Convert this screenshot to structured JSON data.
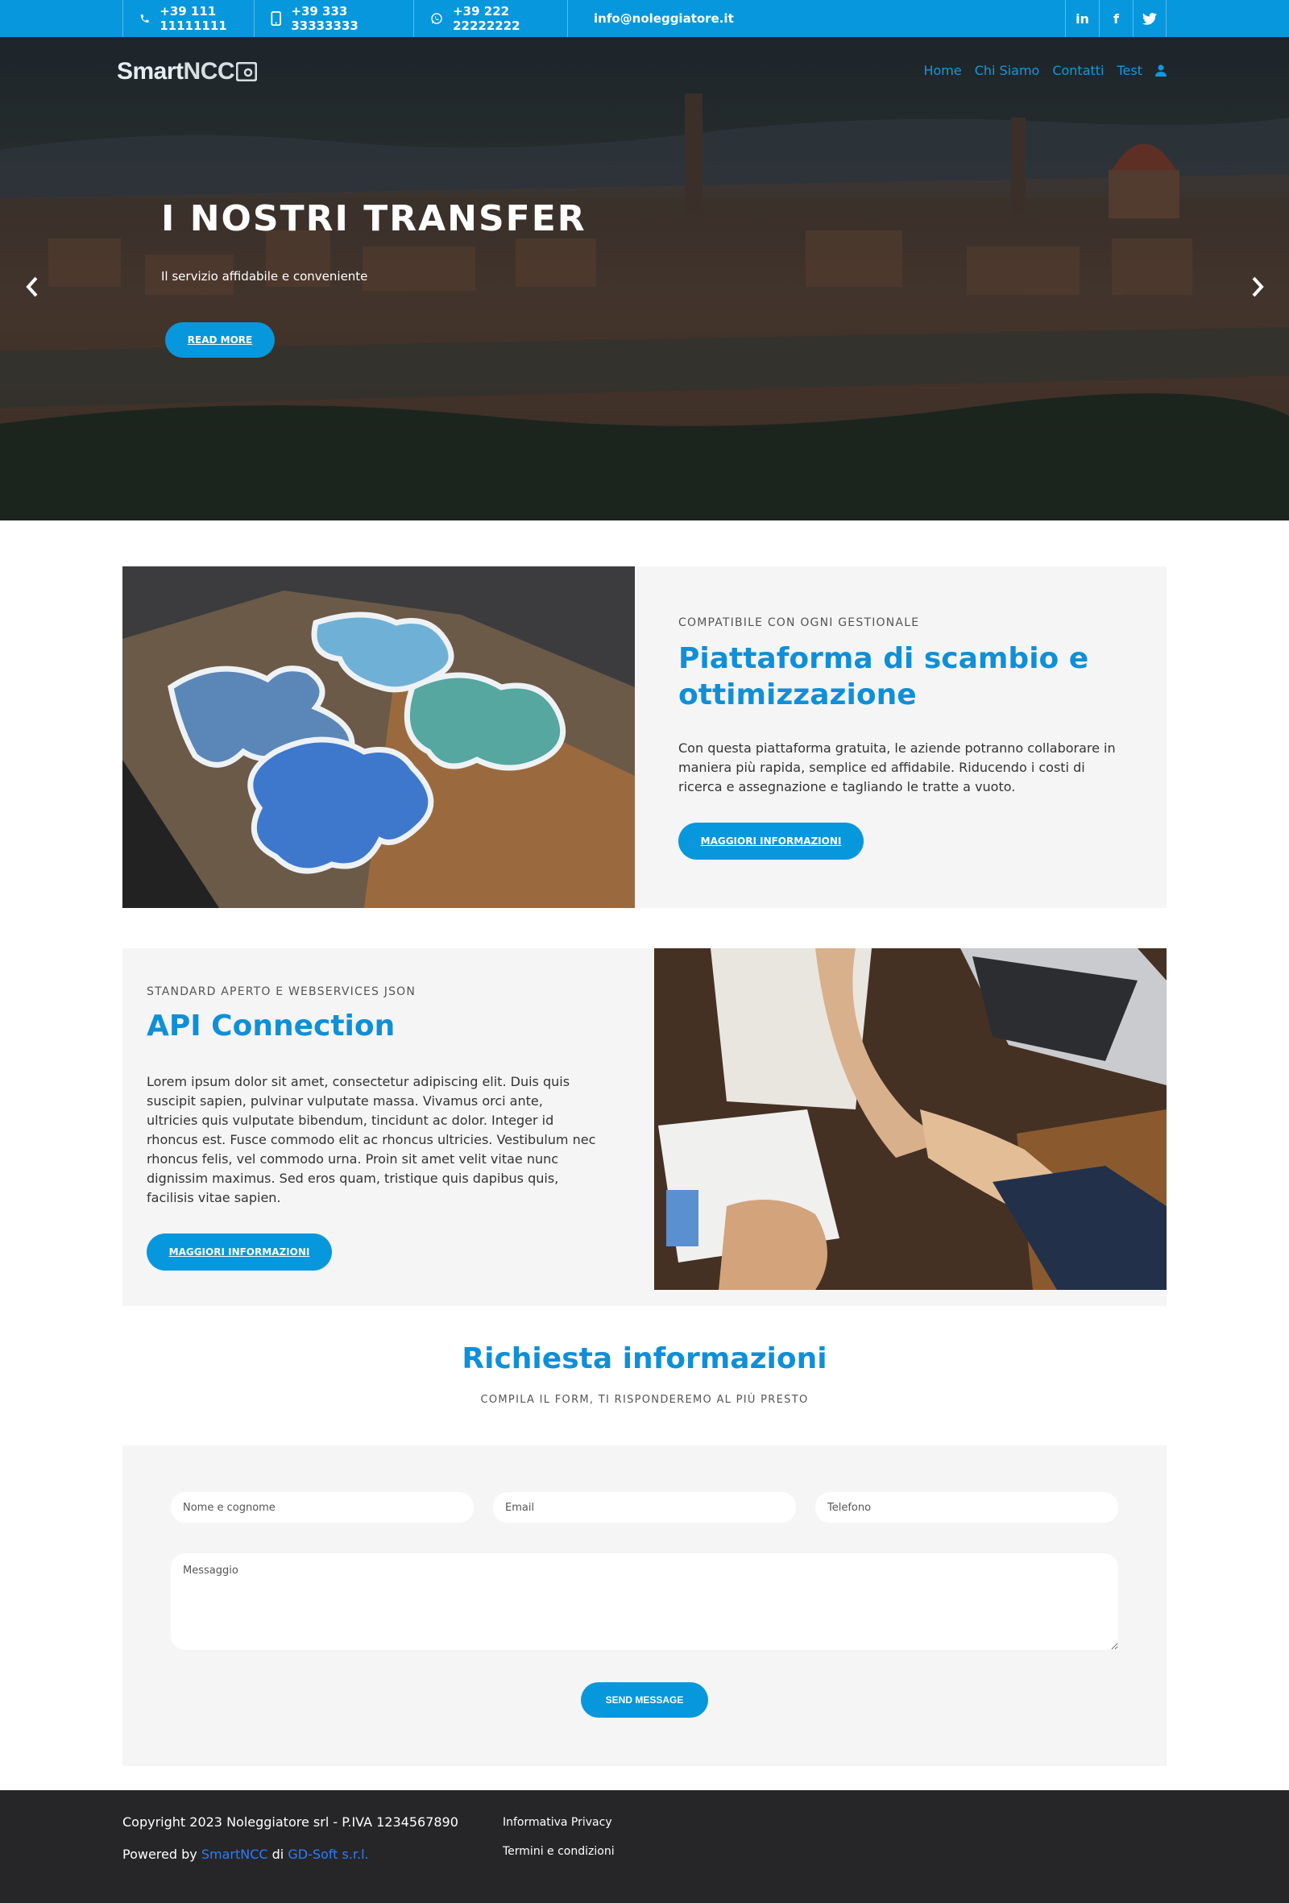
{
  "topbar": {
    "phone": "+39 111 11111111",
    "mobile": "+39 333 33333333",
    "whatsapp": "+39 222 22222222",
    "email": "info@noleggiatore.it",
    "social": {
      "linkedin": "in",
      "facebook": "f"
    },
    "icons": [
      "phone-icon",
      "mobile-icon",
      "whatsapp-icon",
      "envelope-icon",
      "linkedin-icon",
      "facebook-icon",
      "twitter-icon"
    ]
  },
  "brand": {
    "logo_bold": "Smart",
    "logo_light": "NCC"
  },
  "nav": {
    "items": [
      "Home",
      "Chi Siamo",
      "Contatti",
      "Test"
    ],
    "user_icon": "user-icon"
  },
  "hero": {
    "title": "I NOSTRI TRANSFER",
    "subtitle": "Il servizio affidabile e conveniente",
    "button": "READ MORE"
  },
  "feature1": {
    "kicker": "COMPATIBILE CON OGNI GESTIONALE",
    "title": "Piattaforma di scambio e ottimizzazione",
    "text": "Con questa piattaforma gratuita, le aziende potranno collaborare in maniera più rapida, semplice ed affidabile. Riducendo i costi di ricerca e assegnazione e tagliando le tratte a vuoto.",
    "button": "MAGGIORI INFORMAZIONI"
  },
  "feature2": {
    "kicker": "STANDARD APERTO E WEBSERVICES JSON",
    "title": "API Connection",
    "text": "Lorem ipsum dolor sit amet, consectetur adipiscing elit. Duis quis suscipit sapien, pulvinar vulputate massa. Vivamus orci ante, ultricies quis vulputate bibendum, tincidunt ac dolor. Integer id rhoncus est. Fusce commodo elit ac rhoncus ultricies. Vestibulum nec rhoncus felis, vel commodo urna. Proin sit amet velit vitae nunc dignissim maximus. Sed eros quam, tristique quis dapibus quis, facilisis vitae sapien.",
    "button": "MAGGIORI INFORMAZIONI"
  },
  "form": {
    "title": "Richiesta informazioni",
    "subtitle": "COMPILA IL FORM, TI RISPONDEREMO AL PIÙ PRESTO",
    "name_placeholder": "Nome e cognome",
    "email_placeholder": "Email",
    "phone_placeholder": "Telefono",
    "message_placeholder": "Messaggio",
    "send": "SEND MESSAGE"
  },
  "footer": {
    "copyright": "Copyright 2023 Noleggiatore srl - P.IVA 1234567890",
    "powered_prefix": "Powered by",
    "powered_product": "SmartNCC",
    "powered_mid": "di",
    "powered_company": "GD-Soft s.r.l.",
    "privacy": "Informativa Privacy",
    "terms": "Termini e condizioni"
  },
  "colors": {
    "accent": "#0797dd",
    "title_blue": "#0f8fd8",
    "panel": "#f5f5f5",
    "footer": "#262629"
  }
}
